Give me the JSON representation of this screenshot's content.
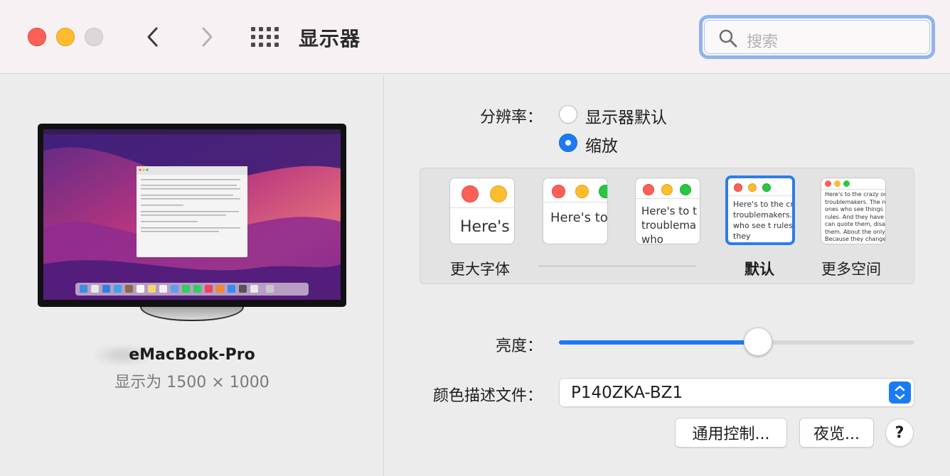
{
  "window": {
    "title": "显示器"
  },
  "search": {
    "placeholder": "搜索"
  },
  "display": {
    "name_visible": "eMacBook-Pro",
    "resolution_text": "显示为 1500 × 1000"
  },
  "resolution": {
    "label": "分辨率：",
    "options": [
      {
        "label": "显示器默认",
        "selected": false
      },
      {
        "label": "缩放",
        "selected": true
      }
    ]
  },
  "scale_options": [
    {
      "label": "更大字体",
      "preview_text": "Here's",
      "selected": false
    },
    {
      "label": "",
      "preview_text": "Here's to troublem",
      "selected": false
    },
    {
      "label": "",
      "preview_text": "Here's to t troublema ones who",
      "selected": false
    },
    {
      "label": "默认",
      "preview_text": "Here's to the cr troublemakers. ones who see t rules. And they",
      "selected": true
    },
    {
      "label": "更多空间",
      "preview_text": "Here's to the crazy ones troublemakers. The rou ones who see things dif rules. And they have no can quote them, disagre them. About the only th Because they change th",
      "selected": false
    }
  ],
  "brightness": {
    "label": "亮度：",
    "value": 0.56
  },
  "color_profile": {
    "label": "颜色描述文件：",
    "value": "P140ZKA-BZ1"
  },
  "buttons": {
    "universal_control": "通用控制...",
    "night_shift": "夜览...",
    "help": "?"
  },
  "colors": {
    "accent": "#1a7bf5",
    "close": "#fe5f57",
    "minimize": "#febc2e",
    "zoom_disabled": "#dcd7da",
    "preview_green": "#28c840"
  },
  "icons": [
    "back-chevron-icon",
    "forward-chevron-icon",
    "show-all-grid-icon",
    "search-icon",
    "popup-stepper-icon"
  ]
}
